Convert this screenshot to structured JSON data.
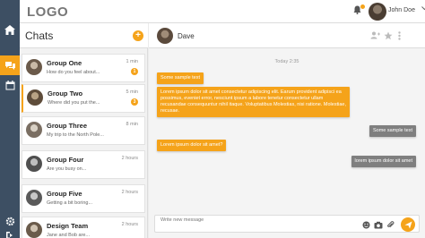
{
  "app": {
    "logo": "LOGO"
  },
  "user": {
    "name": "John Doe"
  },
  "chats": {
    "title": "Chats",
    "add_label": "+",
    "items": [
      {
        "name": "Group One",
        "preview": "How do you feel about...",
        "time": "1 min",
        "badge": "1",
        "active": false
      },
      {
        "name": "Group Two",
        "preview": "Where did you put the...",
        "time": "5 min",
        "badge": "3",
        "active": true
      },
      {
        "name": "Group Three",
        "preview": "My trip to the North Pole...",
        "time": "8 min",
        "badge": "",
        "active": false
      },
      {
        "name": "Group Four",
        "preview": "Are you busy on...",
        "time": "2 hours",
        "badge": "",
        "active": false
      },
      {
        "name": "Group Five",
        "preview": "Getting a bit boring...",
        "time": "2 hours",
        "badge": "",
        "active": false
      },
      {
        "name": "Design Team",
        "preview": "Jane and Bob are...",
        "time": "2 hours",
        "badge": "",
        "active": false
      }
    ]
  },
  "conversation": {
    "contact": "Dave",
    "day_separator": "Today 2:35",
    "messages": [
      {
        "dir": "in",
        "text": "Some sample text"
      },
      {
        "dir": "in",
        "text": "Lorem ipsum dolor sit amet consectetur adipiscing elit. Earum provident adipisci ea possimus, eveniet error, nesciunt ipsum a labore tenetur consectetur ullam recusandae consequuntur nihil itaque. Voluptatibus Molestias, nisi ratione. Molestiae, recusae."
      },
      {
        "dir": "out",
        "text": "Some sample text"
      },
      {
        "dir": "in",
        "text": "Lorem ipsum dolor sit amet?"
      },
      {
        "dir": "out",
        "text": "lorem ipsum dolor sit amet"
      }
    ],
    "composer_placeholder": "Write new message"
  },
  "colors": {
    "accent": "#f5a31a",
    "rail": "#3d4f63",
    "outgoing": "#7f7f7f"
  },
  "icons": {
    "rail": [
      "home-icon",
      "chat-icon",
      "calendar-icon",
      "settings-icon",
      "logout-icon"
    ],
    "topbar": [
      "bell-icon",
      "chevron-down-icon"
    ],
    "conversation_header": [
      "add-user-icon",
      "star-icon",
      "more-icon"
    ],
    "composer": [
      "emoji-icon",
      "camera-icon",
      "attach-icon",
      "send-icon"
    ]
  }
}
